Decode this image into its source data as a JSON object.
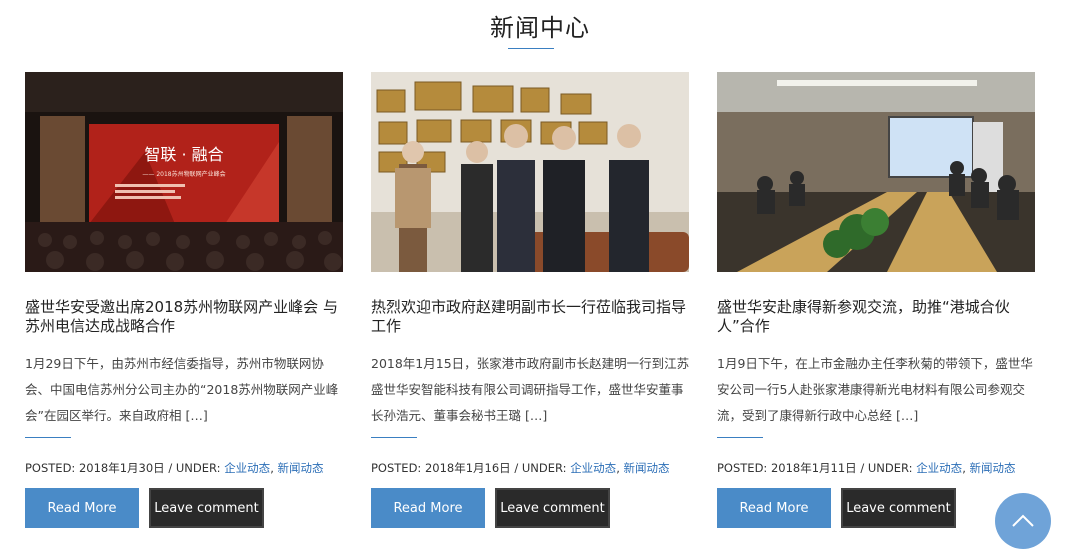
{
  "section": {
    "title": "新闻中心"
  },
  "colors": {
    "accent": "#3a7fc1",
    "read_more_bg": "#4a8bc8",
    "leave_comment_bg": "#2a2a2a",
    "link": "#2d6fb7"
  },
  "posts": [
    {
      "title": "盛世华安受邀出席2018苏州物联网产业峰会 与苏州电信达成战略合作",
      "excerpt": "1月29日下午，由苏州市经信委指导，苏州市物联网协会、中国电信苏州分公司主办的“2018苏州物联网产业峰会”在园区举行。来自政府相 […]",
      "posted_label": "POSTED:",
      "date": "2018年1月30日",
      "under_label": "/ UNDER:",
      "category1": "企业动态",
      "category2": "新闻动态",
      "read_more": "Read More",
      "leave_comment": "Leave comment",
      "image": {
        "stage_title": "智联 · 融合",
        "stage_subtitle": "—— 2018苏州物联网产业峰会"
      }
    },
    {
      "title": "热烈欢迎市政府赵建明副市长一行莅临我司指导工作",
      "excerpt": "2018年1月15日，张家港市政府副市长赵建明一行到江苏盛世华安智能科技有限公司调研指导工作，盛世华安董事长孙浩元、董事会秘书王璐 […]",
      "posted_label": "POSTED:",
      "date": "2018年1月16日",
      "under_label": "/ UNDER:",
      "category1": "企业动态",
      "category2": "新闻动态",
      "read_more": "Read More",
      "leave_comment": "Leave comment"
    },
    {
      "title": "盛世华安赴康得新参观交流，助推“港城合伙人”合作",
      "excerpt": "1月9日下午，在上市金融办主任李秋菊的带领下，盛世华安公司一行5人赴张家港康得新光电材料有限公司参观交流，受到了康得新行政中心总经 […]",
      "posted_label": "POSTED:",
      "date": "2018年1月11日",
      "under_label": "/ UNDER:",
      "category1": "企业动态",
      "category2": "新闻动态",
      "read_more": "Read More",
      "leave_comment": "Leave comment"
    }
  ],
  "back_to_top": {
    "icon": "chevron-up-icon"
  }
}
